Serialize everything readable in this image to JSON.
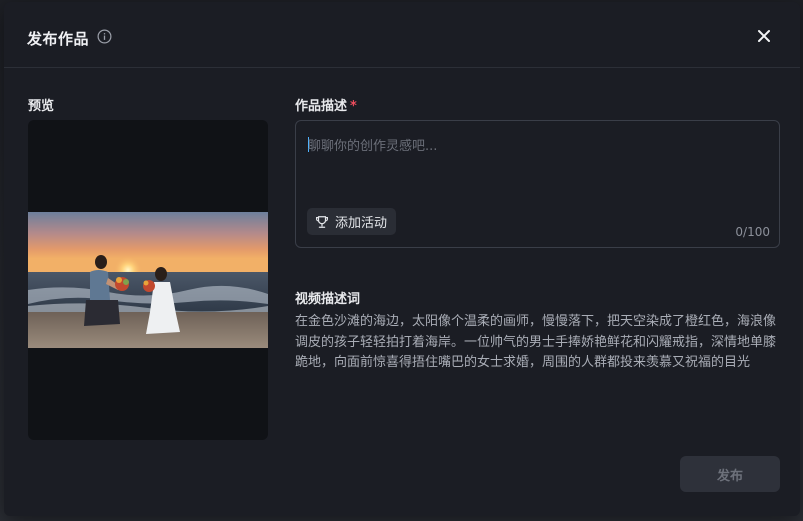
{
  "dialog": {
    "title": "发布作品",
    "close_icon": "close-icon",
    "info_icon": "info-icon"
  },
  "preview": {
    "label": "预览"
  },
  "description": {
    "label": "作品描述",
    "required_mark": "*",
    "placeholder": "聊聊你的创作灵感吧...",
    "value": "",
    "add_activity_label": "添加活动",
    "add_activity_icon": "trophy-icon",
    "counter": "0/100"
  },
  "video_description": {
    "label": "视频描述词",
    "text": "在金色沙滩的海边，太阳像个温柔的画师，慢慢落下，把天空染成了橙红色，海浪像调皮的孩子轻轻拍打着海岸。一位帅气的男士手捧娇艳鲜花和闪耀戒指，深情地单膝跪地，向面前惊喜得捂住嘴巴的女士求婚，周围的人群都投来羡慕又祝福的目光"
  },
  "actions": {
    "publish_label": "发布"
  },
  "colors": {
    "accent_required": "#f04e5e",
    "modal_bg": "#1b1d24",
    "publish_disabled_bg": "#2e313a"
  }
}
